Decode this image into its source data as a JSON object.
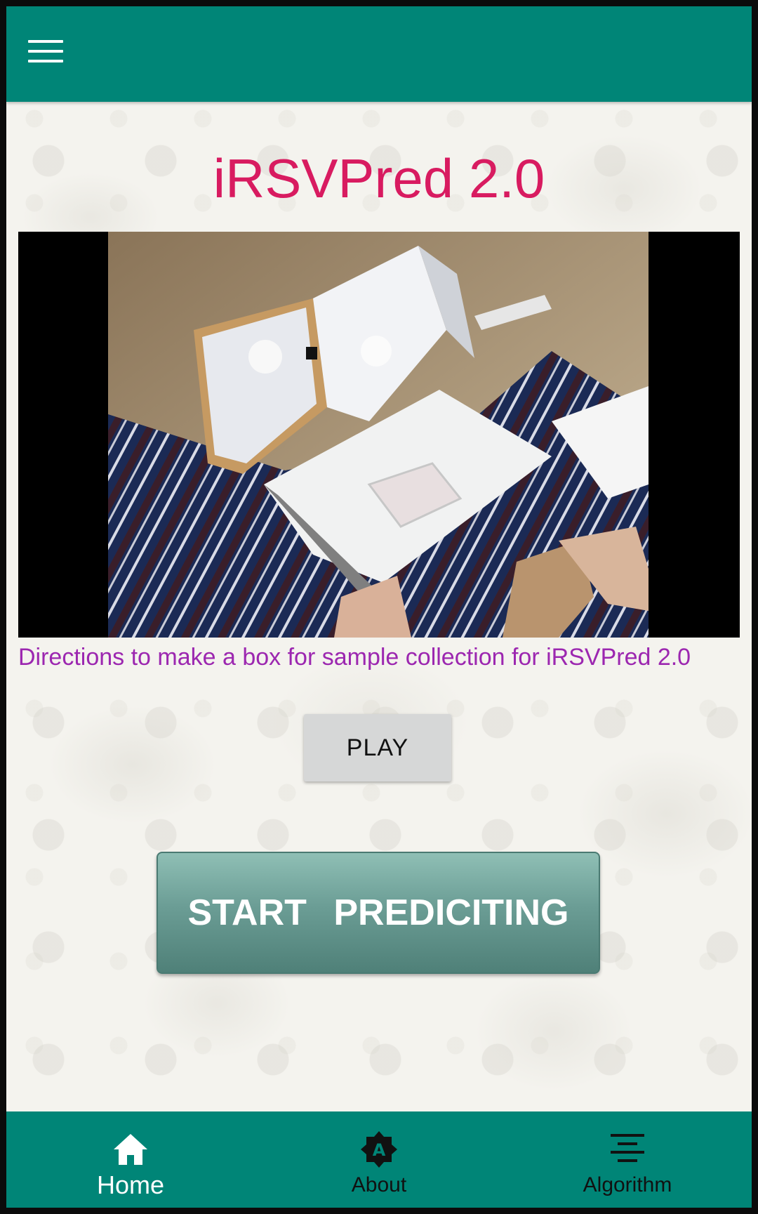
{
  "app": {
    "title": "iRSVPred 2.0"
  },
  "topbar": {
    "menu_icon": "hamburger-menu-icon"
  },
  "video": {
    "caption": "Directions to make a box for sample collection for iRSVPred 2.0"
  },
  "buttons": {
    "play_label": "PLAY",
    "start_label": "START   PREDICITING"
  },
  "bottom_nav": {
    "items": [
      {
        "label": "Home",
        "icon": "home-icon",
        "active": true
      },
      {
        "label": "About",
        "icon": "about-badge-icon",
        "active": false
      },
      {
        "label": "Algorithm",
        "icon": "align-center-icon",
        "active": false
      }
    ]
  },
  "colors": {
    "primary": "#008577",
    "title": "#d81b60",
    "caption": "#9c27b0",
    "nav_inactive": "#111111",
    "nav_active": "#ffffff"
  }
}
